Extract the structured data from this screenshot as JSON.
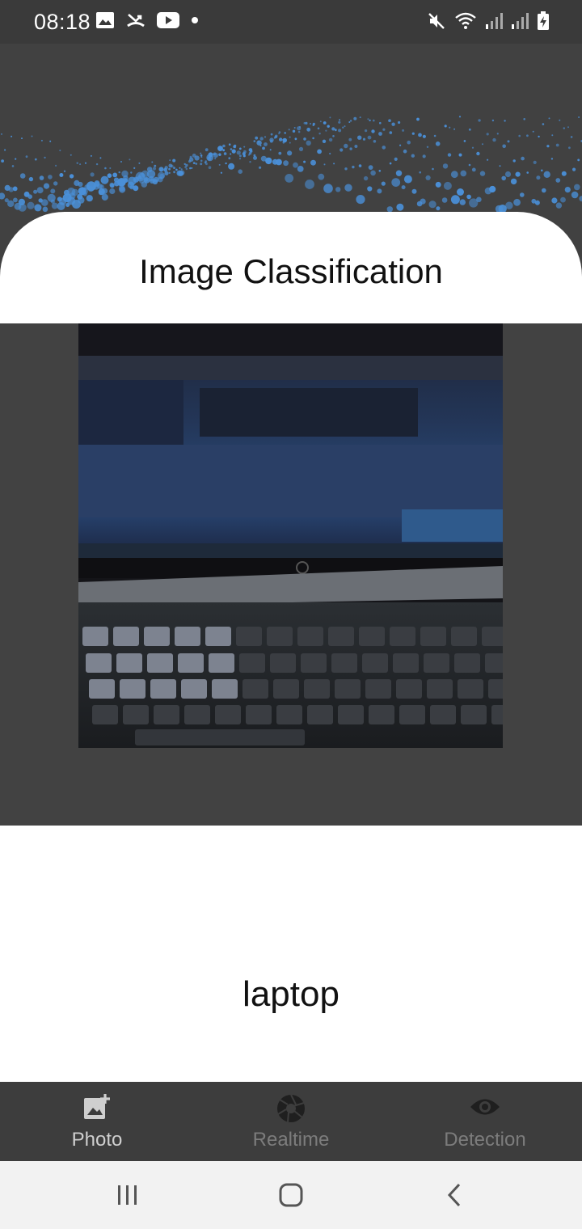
{
  "status_bar": {
    "time": "08:18",
    "left_icons": [
      "image-icon",
      "missed-call-icon",
      "youtube-icon",
      "dot-icon"
    ],
    "right_icons": [
      "mute-icon",
      "wifi-icon",
      "signal-icon",
      "signal-icon",
      "battery-icon"
    ]
  },
  "header": {
    "title": "Image Classification"
  },
  "result": {
    "label": "laptop"
  },
  "bottom_nav": {
    "items": [
      {
        "label": "Photo",
        "icon": "add-photo-icon",
        "active": true
      },
      {
        "label": "Realtime",
        "icon": "camera-shutter-icon",
        "active": false
      },
      {
        "label": "Detection",
        "icon": "eye-icon",
        "active": false
      }
    ]
  },
  "colors": {
    "background": "#414141",
    "card": "#ffffff",
    "accent_dots": "#4a90d9",
    "nav_active": "#cfcfcf",
    "nav_inactive": "#7c7c7c"
  }
}
